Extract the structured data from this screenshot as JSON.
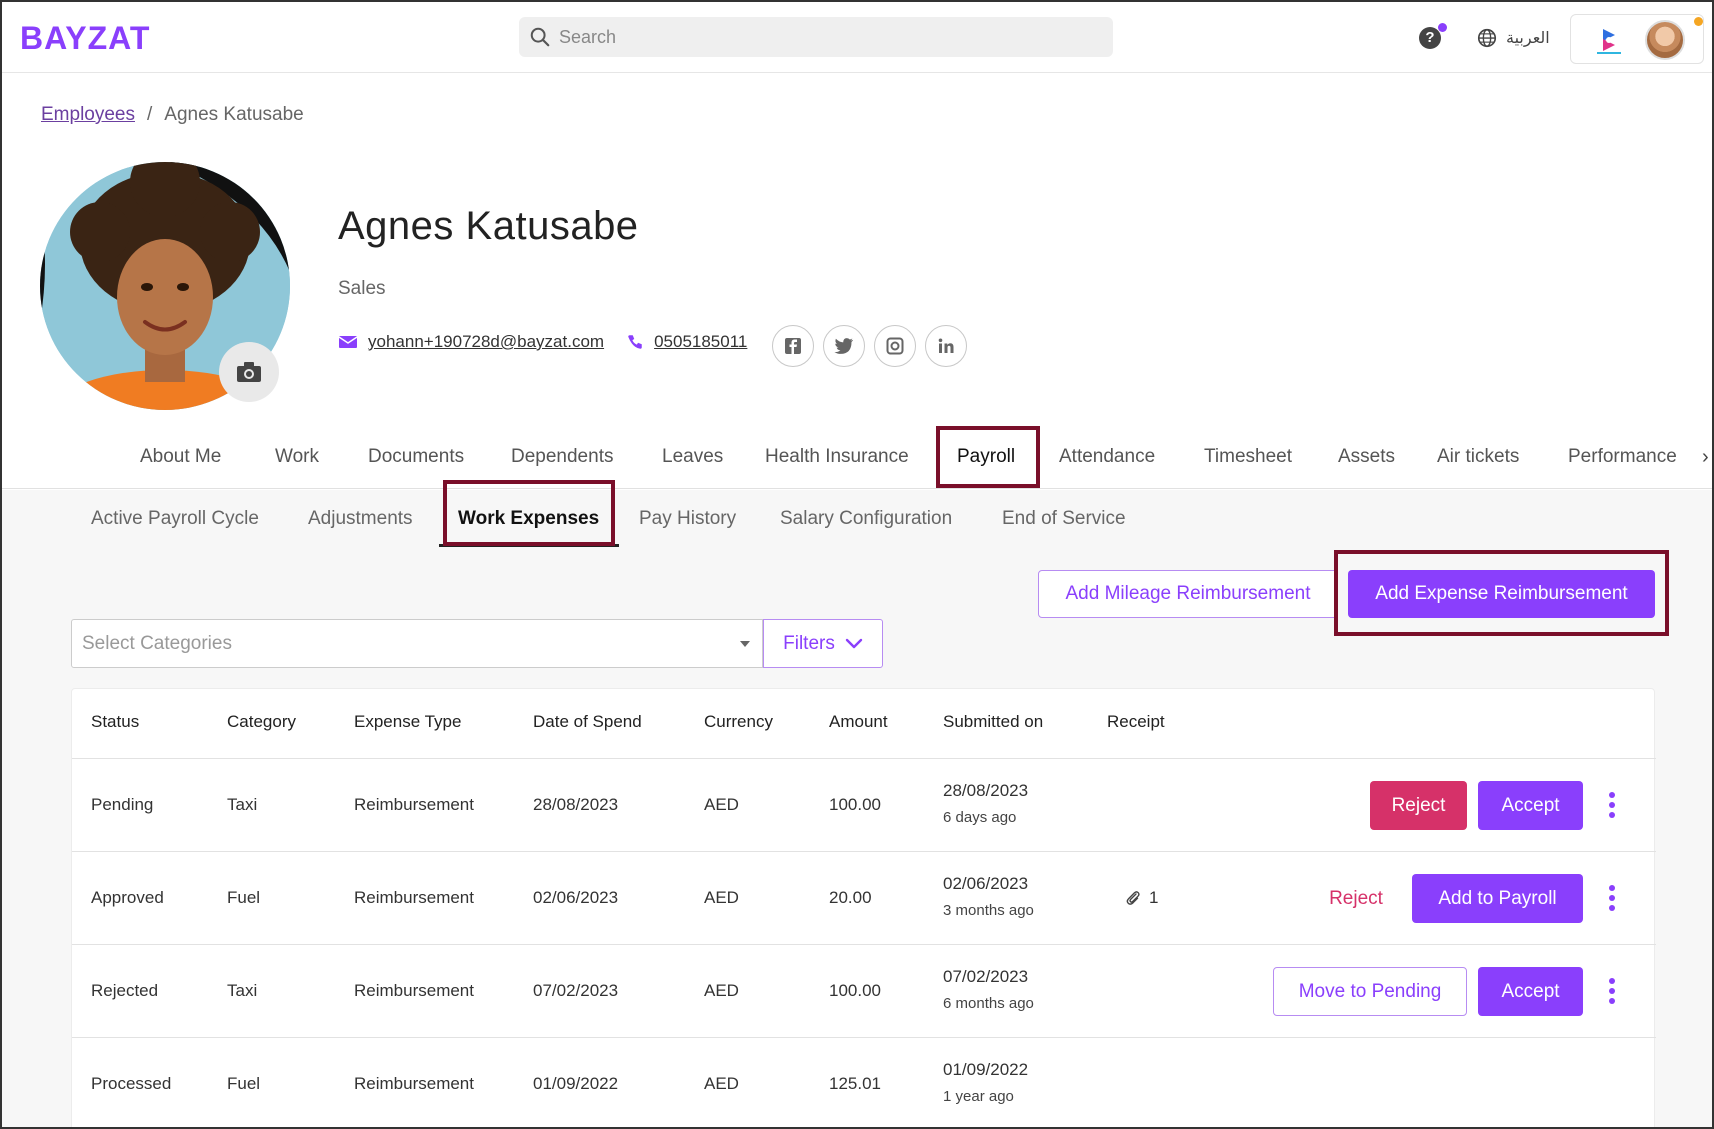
{
  "brand": {
    "logo_text": "BAYZAT",
    "accent": "#8a3ffc"
  },
  "topbar": {
    "search_placeholder": "Search",
    "help_label": "?",
    "language_label": "العربية"
  },
  "breadcrumb": {
    "root": "Employees",
    "separator": "/",
    "current": "Agnes Katusabe"
  },
  "employee": {
    "name": "Agnes Katusabe",
    "department": "Sales",
    "email": "yohann+190728d@bayzat.com",
    "phone": "0505185011",
    "social": [
      "facebook-icon",
      "twitter-icon",
      "instagram-icon",
      "linkedin-icon"
    ]
  },
  "main_tabs": [
    "About Me",
    "Work",
    "Documents",
    "Dependents",
    "Leaves",
    "Health Insurance",
    "Payroll",
    "Attendance",
    "Timesheet",
    "Assets",
    "Air tickets",
    "Performance"
  ],
  "main_tab_active": "Payroll",
  "sub_tabs": [
    "Active Payroll Cycle",
    "Adjustments",
    "Work Expenses",
    "Pay History",
    "Salary Configuration",
    "End of Service"
  ],
  "sub_tab_active": "Work Expenses",
  "actions": {
    "add_mileage": "Add Mileage Reimbursement",
    "add_expense": "Add Expense Reimbursement"
  },
  "filters": {
    "category_placeholder": "Select Categories",
    "filters_label": "Filters"
  },
  "table": {
    "headers": [
      "Status",
      "Category",
      "Expense Type",
      "Date of Spend",
      "Currency",
      "Amount",
      "Submitted on",
      "Receipt"
    ],
    "rows": [
      {
        "status": "Pending",
        "category": "Taxi",
        "type": "Reimbursement",
        "date": "28/08/2023",
        "currency": "AED",
        "amount": "100.00",
        "submitted": "28/08/2023",
        "ago": "6 days ago",
        "receipt": "",
        "action1": "Reject",
        "action2": "Accept"
      },
      {
        "status": "Approved",
        "category": "Fuel",
        "type": "Reimbursement",
        "date": "02/06/2023",
        "currency": "AED",
        "amount": "20.00",
        "submitted": "02/06/2023",
        "ago": "3 months ago",
        "receipt": "1",
        "action1": "Reject",
        "action2": "Add to Payroll"
      },
      {
        "status": "Rejected",
        "category": "Taxi",
        "type": "Reimbursement",
        "date": "07/02/2023",
        "currency": "AED",
        "amount": "100.00",
        "submitted": "07/02/2023",
        "ago": "6 months ago",
        "receipt": "",
        "action1": "Move to Pending",
        "action2": "Accept"
      },
      {
        "status": "Processed",
        "category": "Fuel",
        "type": "Reimbursement",
        "date": "01/09/2022",
        "currency": "AED",
        "amount": "125.01",
        "submitted": "01/09/2022",
        "ago": "1 year ago",
        "receipt": "",
        "action1": "",
        "action2": ""
      }
    ]
  }
}
